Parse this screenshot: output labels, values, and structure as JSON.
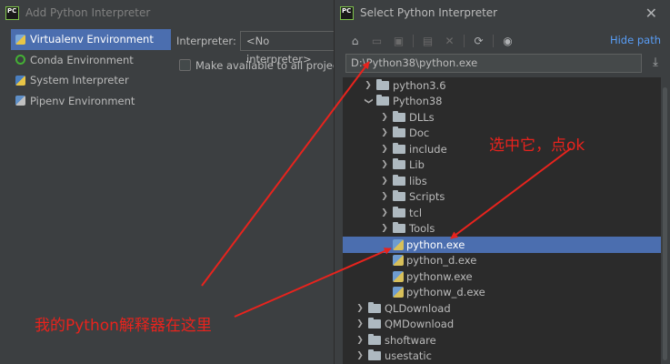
{
  "left_dialog": {
    "title": "Add Python Interpreter",
    "env_items": [
      {
        "label": "Virtualenv Environment",
        "icon": "virtualenv-icon",
        "selected": true
      },
      {
        "label": "Conda Environment",
        "icon": "conda-icon",
        "selected": false
      },
      {
        "label": "System Interpreter",
        "icon": "python-icon",
        "selected": false
      },
      {
        "label": "Pipenv Environment",
        "icon": "pipenv-icon",
        "selected": false
      }
    ],
    "interpreter_label": "Interpreter:",
    "interpreter_value": "<No interpreter>",
    "make_available_label": "Make available to all projects"
  },
  "right_dialog": {
    "title": "Select Python Interpreter",
    "hide_path_label": "Hide path",
    "path_value": "D:\\Python38\\python.exe",
    "tree": [
      {
        "label": "python3.6",
        "kind": "folder",
        "depth": 1,
        "expander": "right"
      },
      {
        "label": "Python38",
        "kind": "folder",
        "depth": 1,
        "expander": "down"
      },
      {
        "label": "DLLs",
        "kind": "folder",
        "depth": 2,
        "expander": "right"
      },
      {
        "label": "Doc",
        "kind": "folder",
        "depth": 2,
        "expander": "right"
      },
      {
        "label": "include",
        "kind": "folder",
        "depth": 2,
        "expander": "right"
      },
      {
        "label": "Lib",
        "kind": "folder",
        "depth": 2,
        "expander": "right"
      },
      {
        "label": "libs",
        "kind": "folder",
        "depth": 2,
        "expander": "right"
      },
      {
        "label": "Scripts",
        "kind": "folder",
        "depth": 2,
        "expander": "right"
      },
      {
        "label": "tcl",
        "kind": "folder",
        "depth": 2,
        "expander": "right"
      },
      {
        "label": "Tools",
        "kind": "folder",
        "depth": 2,
        "expander": "right"
      },
      {
        "label": "python.exe",
        "kind": "pyfile",
        "depth": 2,
        "expander": "none",
        "selected": true
      },
      {
        "label": "python_d.exe",
        "kind": "pyfile",
        "depth": 2,
        "expander": "none"
      },
      {
        "label": "pythonw.exe",
        "kind": "pyfile",
        "depth": 2,
        "expander": "none"
      },
      {
        "label": "pythonw_d.exe",
        "kind": "pyfile",
        "depth": 2,
        "expander": "none"
      },
      {
        "label": "QLDownload",
        "kind": "folder",
        "depth": 0,
        "expander": "right"
      },
      {
        "label": "QMDownload",
        "kind": "folder",
        "depth": 0,
        "expander": "right"
      },
      {
        "label": "shoftware",
        "kind": "folder",
        "depth": 0,
        "expander": "right"
      },
      {
        "label": "usestatic",
        "kind": "folder",
        "depth": 0,
        "expander": "right"
      }
    ]
  },
  "annotations": {
    "select_text": "选中它，点ok",
    "mine_text": "我的Python解释器在这里",
    "color": "#e8231d"
  },
  "colors": {
    "selection": "#4b6eaf",
    "link": "#589df6",
    "panel": "#3c3f41",
    "tree_bg": "#2b2b2b"
  }
}
